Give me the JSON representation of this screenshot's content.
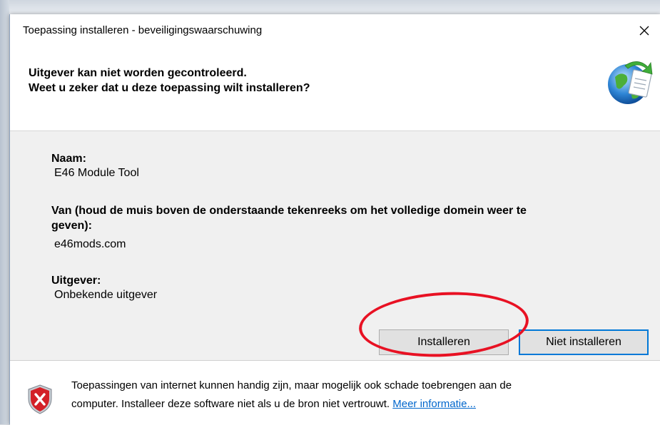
{
  "window": {
    "title": "Toepassing installeren - beveiligingswaarschuwing",
    "close_icon": "close-icon"
  },
  "header": {
    "line1": "Uitgever kan niet worden gecontroleerd.",
    "line2": "Weet u zeker dat u deze toepassing wilt installeren?",
    "icon": "globe-installer-icon"
  },
  "details": {
    "name_label": "Naam:",
    "name_value": "E46 Module Tool",
    "from_label_line1": "Van (houd de muis boven de onderstaande tekenreeks om het volledige domein weer te",
    "from_label_line2": "geven):",
    "from_value": "e46mods.com",
    "publisher_label": "Uitgever:",
    "publisher_value": "Onbekende uitgever"
  },
  "buttons": {
    "install": "Installeren",
    "dont_install": "Niet installeren"
  },
  "footer": {
    "icon": "shield-warning-icon",
    "text_line1": "Toepassingen van internet kunnen handig zijn, maar mogelijk ook schade toebrengen aan de",
    "text_line2": "computer. Installeer deze software niet als u de bron niet vertrouwt.",
    "link": "Meer informatie..."
  },
  "colors": {
    "accent": "#0078d7",
    "highlight_ring": "#e81123",
    "link": "#0066cc"
  }
}
